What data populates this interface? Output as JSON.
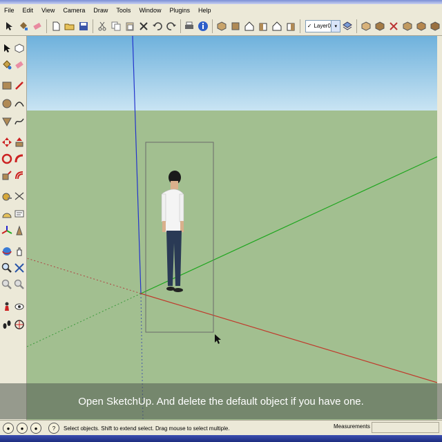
{
  "menu": {
    "items": [
      "File",
      "Edit",
      "View",
      "Camera",
      "Draw",
      "Tools",
      "Window",
      "Plugins",
      "Help"
    ]
  },
  "toolbar": {
    "layer_select_value": "Layer0",
    "layer_check": "✓",
    "dropdown_arrow": "▾"
  },
  "caption": "Open SketchUp. And delete the default object if you have one.",
  "status": {
    "hint": "Select objects. Shift to extend select. Drag mouse to select multiple.",
    "help_glyph": "?",
    "measurements_label": "Measurements",
    "measurements_value": ""
  },
  "colors": {
    "sky_top": "#6eb1dc",
    "ground": "#a2bf90",
    "axis_red": "#c0392b",
    "axis_green": "#1fa61f",
    "axis_blue": "#2233cc"
  },
  "icons": {
    "toolbar": [
      "select-arrow-icon",
      "eraser-icon",
      "paint-bucket-icon",
      "new-file-icon",
      "open-folder-icon",
      "save-icon",
      "cut-icon",
      "copy-icon",
      "paste-icon",
      "delete-icon",
      "undo-icon",
      "redo-icon",
      "print-icon",
      "model-info-icon",
      "iso-view-icon",
      "top-view-icon",
      "front-view-icon",
      "right-view-icon",
      "back-view-icon",
      "left-view-icon",
      "layers-icon",
      "xray-icon",
      "wireframe-icon",
      "hidden-line-icon",
      "shaded-icon",
      "textured-icon",
      "monochrome-icon"
    ],
    "left_tools": [
      "select-icon",
      "make-component-icon",
      "paint-bucket-icon",
      "eraser-icon",
      "rectangle-icon",
      "line-icon",
      "circle-icon",
      "arc-icon",
      "polygon-icon",
      "freehand-icon",
      "move-icon",
      "push-pull-icon",
      "rotate-icon",
      "follow-me-icon",
      "scale-icon",
      "offset-icon",
      "tape-measure-icon",
      "dimension-icon",
      "protractor-icon",
      "text-icon",
      "axes-icon",
      "3d-text-icon",
      "orbit-icon",
      "pan-icon",
      "zoom-icon",
      "zoom-extents-icon",
      "previous-view-icon",
      "next-view-icon",
      "position-camera-icon",
      "look-around-icon",
      "walk-icon",
      "section-plane-icon"
    ]
  }
}
